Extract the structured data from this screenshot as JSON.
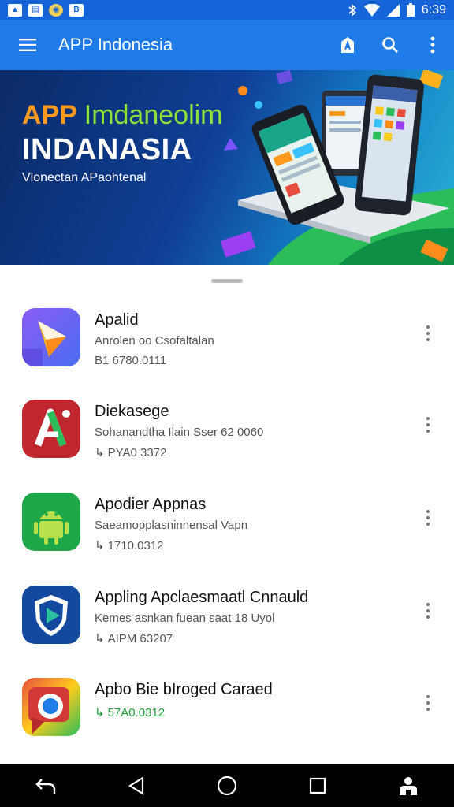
{
  "status_bar": {
    "time": "6:39",
    "icons": [
      "notification-icon",
      "chart-icon",
      "settings-icon",
      "bold-b-icon",
      "bluetooth-icon",
      "wifi-icon",
      "signal-icon",
      "battery-icon"
    ]
  },
  "app_bar": {
    "title": "APP Indonesia",
    "icons": [
      "menu-icon",
      "store-icon",
      "search-icon",
      "more-vert-icon"
    ]
  },
  "banner": {
    "line1_a": "APP",
    "line1_b": "Imdaneolim",
    "line2": "INDANASIA",
    "tagline": "Vlonectan APaohtenal"
  },
  "apps": [
    {
      "name": "Apalid",
      "description": "Anrolen oo Csofaltalan",
      "meta": "B1 6780.0111",
      "meta_icon": "",
      "icon": "play-triangle-icon"
    },
    {
      "name": "Diekasege",
      "description": "Sohanandtha Ilain Sser 62 0060",
      "meta": "PYA0 3372",
      "meta_icon": "↳",
      "icon": "letter-a-icon"
    },
    {
      "name": "Apodier Appnas",
      "description": "Saeamopplasninnensal Vapn",
      "meta": "1710.0312",
      "meta_icon": "↳",
      "icon": "android-icon"
    },
    {
      "name": "Appling Apclaesmaatl Cnnauld",
      "description": "Kemes asnkan fuean saat 18 Uyol",
      "meta": "AIPM 63207",
      "meta_icon": "↳",
      "icon": "shield-play-icon"
    },
    {
      "name": "Apbo Bie bIroged Caraed",
      "description": "",
      "meta": "57A0.0312",
      "meta_icon": "↳",
      "icon": "browser-ring-icon"
    }
  ],
  "colors": {
    "status_bar": "#1565d8",
    "app_bar": "#1e7be8",
    "meta_green": "#1e9a3a"
  },
  "nav_bar": {
    "icons": [
      "back-icon",
      "triangle-back-icon",
      "home-icon",
      "recents-icon",
      "account-icon"
    ]
  }
}
